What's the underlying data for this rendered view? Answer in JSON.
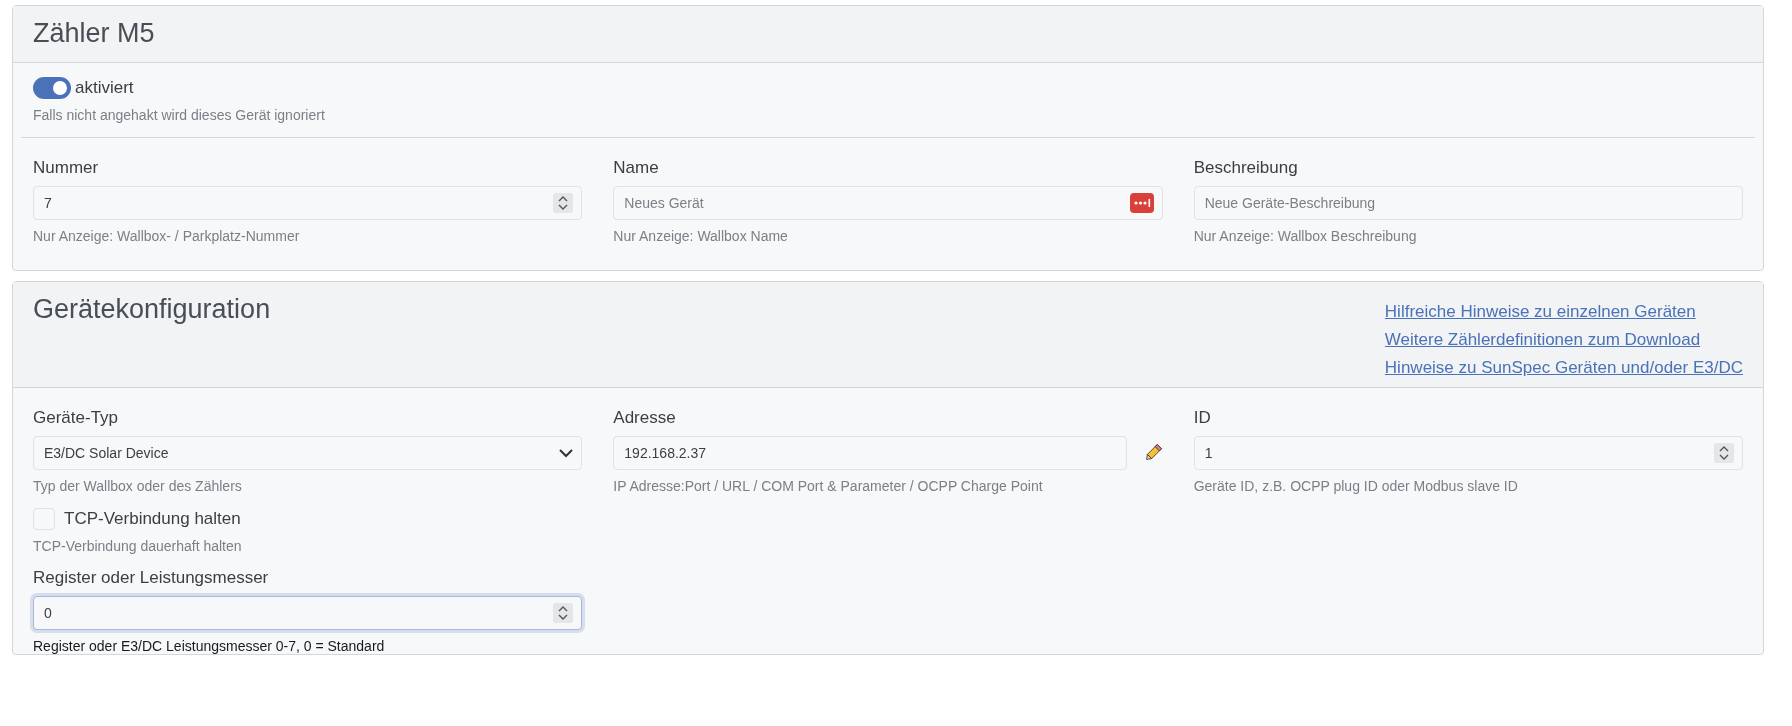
{
  "device_card": {
    "title": "Zähler M5",
    "enable_switch": {
      "label": "aktiviert",
      "on": true,
      "help": "Falls nicht angehakt wird dieses Gerät ignoriert"
    },
    "fields": [
      {
        "kind": "spin",
        "label": "Nummer",
        "value": "7",
        "help": "Nur Anzeige: Wallbox- / Parkplatz-Nummer"
      },
      {
        "kind": "keyfill",
        "label": "Name",
        "placeholder": "Neues Gerät",
        "help": "Nur Anzeige: Wallbox Name"
      },
      {
        "kind": "text",
        "label": "Beschreibung",
        "placeholder": "Neue Geräte-Beschreibung",
        "help": "Nur Anzeige: Wallbox Beschreibung"
      }
    ]
  },
  "config_card": {
    "title": "Gerätekonfiguration",
    "links": [
      "Hilfreiche Hinweise zu einzelnen Geräten",
      "Weitere Zählerdefinitionen zum Download",
      "Hinweise zu SunSpec Geräten und/oder E3/DC"
    ],
    "fields": [
      {
        "kind": "select",
        "label": "Geräte-Typ",
        "value": "E3/DC Solar Device",
        "help": "Typ der Wallbox oder des Zählers"
      },
      {
        "kind": "editable",
        "label": "Adresse",
        "value": "192.168.2.37",
        "help": "IP Adresse:Port / URL / COM Port & Parameter / OCPP Charge Point"
      },
      {
        "kind": "spin",
        "label": "ID",
        "value": "1",
        "help": "Geräte ID, z.B. OCPP plug ID oder Modbus slave ID"
      }
    ],
    "keep_tcp": {
      "label": "TCP-Verbindung halten",
      "checked": false,
      "help": "TCP-Verbindung dauerhaft halten"
    },
    "register": {
      "kind": "spin",
      "label": "Register oder Leistungsmesser",
      "value": "0",
      "focused": true,
      "help": "Register oder E3/DC Leistungsmesser 0-7, 0 = Standard"
    }
  }
}
